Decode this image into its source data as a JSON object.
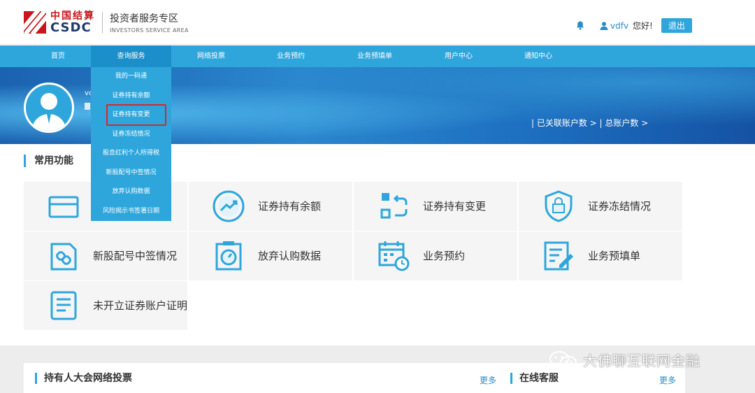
{
  "header": {
    "logo_cn": "中国结算",
    "logo_en": "CSDC",
    "subtitle_cn": "投资者服务专区",
    "subtitle_en": "INVESTORS SERVICE AREA",
    "username": "vdfv",
    "greeting": "您好!",
    "logout_label": "退出"
  },
  "nav": {
    "items": [
      "首页",
      "查询服务",
      "网络投票",
      "业务预约",
      "业务预填单",
      "用户中心",
      "通知中心"
    ]
  },
  "dropdown": {
    "items": [
      "我的一码通",
      "证券持有余额",
      "证券持有变更",
      "证券冻结情况",
      "股息红利个人所得税",
      "新股配号中签情况",
      "放弃认购数据",
      "风险揭示书签署日期"
    ]
  },
  "banner": {
    "user_short": "vc",
    "account_info": "| 已关联账户数 > | 总账户数 >"
  },
  "common": {
    "title": "常用功能",
    "cards": [
      "",
      "证券持有余额",
      "证券持有变更",
      "证券冻结情况",
      "新股配号中签情况",
      "放弃认购数据",
      "业务预约",
      "业务预填单",
      "未开立证券账户证明"
    ]
  },
  "lower": {
    "vote_title": "持有人大会网络投票",
    "vote_more": "更多",
    "service_title": "在线客服",
    "service_more": "更多"
  },
  "watermark": "大佛聊互联网金融",
  "colors": {
    "primary": "#2ea6dc",
    "highlight": "#d9262c",
    "brand_red": "#c8161d"
  }
}
